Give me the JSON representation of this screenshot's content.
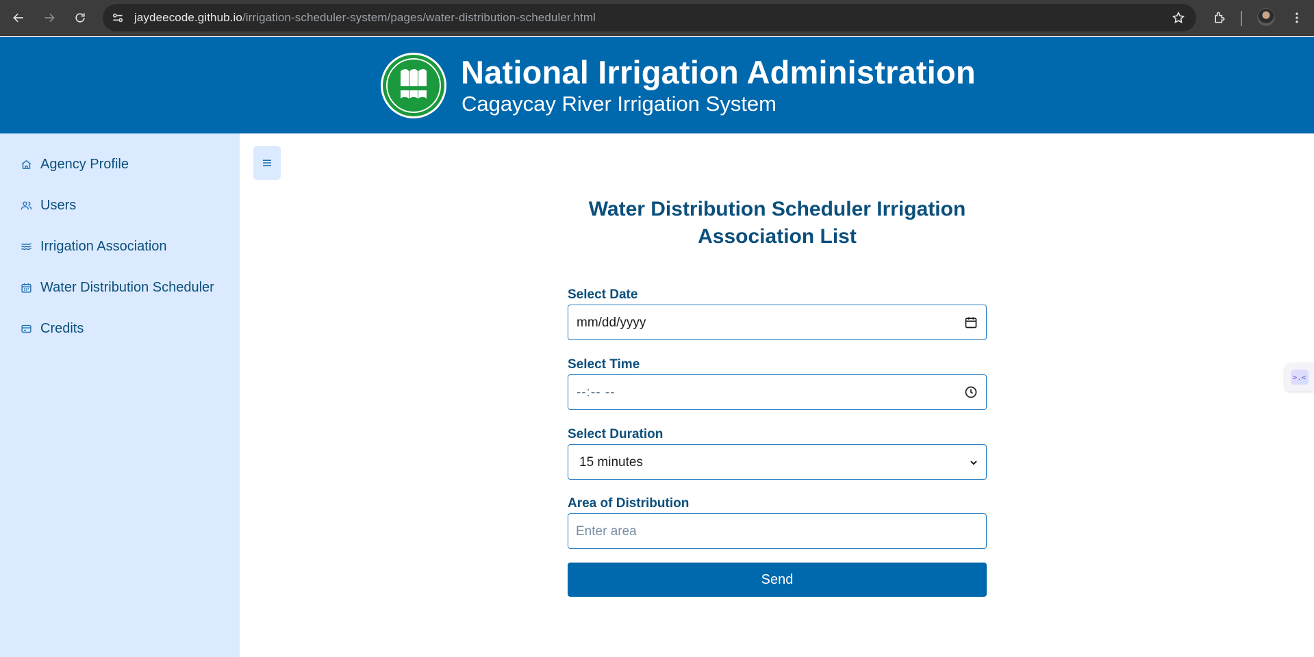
{
  "browser": {
    "url_host": "jaydeecode.github.io",
    "url_path": "/irrigation-scheduler-system/pages/water-distribution-scheduler.html"
  },
  "header": {
    "title": "National Irrigation Administration",
    "subtitle": "Cagaycay River Irrigation System",
    "logo_icon": "nia-seal-logo"
  },
  "sidebar": {
    "items": [
      {
        "label": "Agency Profile",
        "icon": "home-icon"
      },
      {
        "label": "Users",
        "icon": "users-icon"
      },
      {
        "label": "Irrigation Association",
        "icon": "waves-icon"
      },
      {
        "label": "Water Distribution Scheduler",
        "icon": "calendar-icon"
      },
      {
        "label": "Credits",
        "icon": "card-icon"
      }
    ]
  },
  "main": {
    "title": "Water Distribution Scheduler Irrigation Association List",
    "form": {
      "date_label": "Select Date",
      "date_value": "mm/dd/yyyy",
      "time_label": "Select Time",
      "time_value": "--:-- --",
      "duration_label": "Select Duration",
      "duration_value": "15 minutes",
      "area_label": "Area of Distribution",
      "area_placeholder": "Enter area",
      "send_label": "Send"
    }
  },
  "colors": {
    "brand_blue": "#0068ad",
    "sidebar_bg": "#dbeafe",
    "text_dark_blue": "#0b4f7c"
  }
}
